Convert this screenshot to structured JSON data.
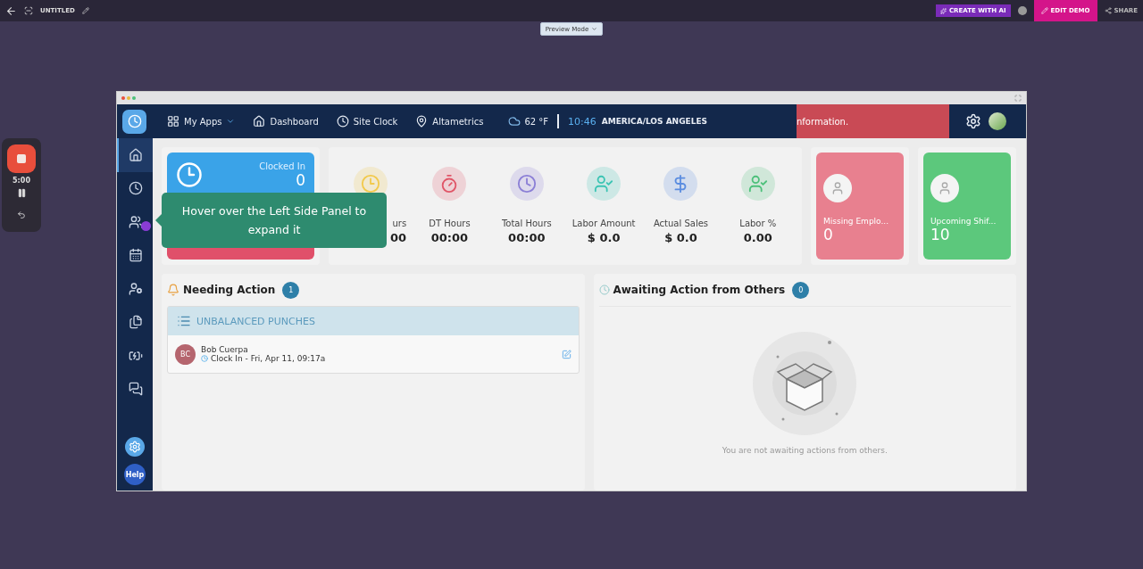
{
  "editor_bar": {
    "title": "UNTITLED",
    "create_button": "CREATE WITH AI",
    "edit_button": "EDIT DEMO",
    "share_button": "SHARE"
  },
  "preview_mode": {
    "label": "Preview Mode"
  },
  "recorder": {
    "time": "5:00"
  },
  "app": {
    "nav": [
      {
        "label": "My Apps",
        "kind": "apps"
      },
      {
        "label": "Dashboard",
        "kind": "home"
      },
      {
        "label": "Site Clock",
        "kind": "clock"
      },
      {
        "label": "Altametrics",
        "kind": "pin"
      }
    ],
    "weather": "62 °F",
    "time": "10:46",
    "timezone": "AMERICA/LOS ANGELES",
    "banner": "nformation.",
    "sidebar": {
      "items": [
        {
          "kind": "home",
          "selected": true
        },
        {
          "kind": "clock",
          "selected": false
        },
        {
          "kind": "users",
          "selected": false
        },
        {
          "kind": "calendar",
          "selected": false
        },
        {
          "kind": "user",
          "selected": false
        },
        {
          "kind": "files",
          "selected": false
        },
        {
          "kind": "battery",
          "selected": false
        },
        {
          "kind": "chat",
          "selected": false
        }
      ],
      "help": "Help"
    },
    "clock_card": {
      "label": "Clocked In",
      "value": "0"
    },
    "metrics": [
      {
        "label": "urs",
        "value": "00",
        "cut": true,
        "color": "#f2c94c"
      },
      {
        "label": "DT Hours",
        "value": "00:00",
        "cut": false,
        "color": "#e05668"
      },
      {
        "label": "Total Hours",
        "value": "00:00",
        "cut": false,
        "color": "#8b7fd6"
      },
      {
        "label": "Labor Amount",
        "value": "$ 0.0",
        "cut": false,
        "color": "#3cc4b4"
      },
      {
        "label": "Actual Sales",
        "value": "$ 0.0",
        "cut": false,
        "color": "#5b8de0"
      },
      {
        "label": "Labor %",
        "value": "0.00",
        "cut": false,
        "color": "#4cc07a"
      }
    ],
    "summary_cards": [
      {
        "label": "Missing Emplo...",
        "value": "0",
        "color": "#e8808f"
      },
      {
        "label": "Upcoming Shif...",
        "value": "10",
        "color": "#5cc87c"
      }
    ],
    "needing_action": {
      "title": "Needing Action",
      "count": "1",
      "group": "UNBALANCED PUNCHES",
      "items": [
        {
          "initials": "BC",
          "name": "Bob Cuerpa",
          "detail": "Clock In - Fri, Apr 11, 09:17a"
        }
      ]
    },
    "awaiting_action": {
      "title": "Awaiting Action from Others",
      "count": "0",
      "empty_text": "You are not awaiting actions from others."
    }
  },
  "tooltip": {
    "text": "Hover over the Left Side Panel to expand it"
  }
}
